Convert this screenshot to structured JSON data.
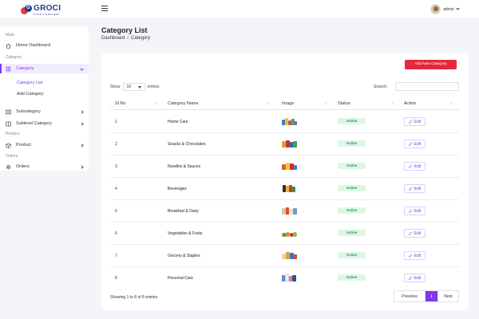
{
  "brand": {
    "name": "GROCI",
    "tagline": "FOOD & GROCERY",
    "mark_letter": "G",
    "accent": "#7c3aed",
    "danger": "#e5273b"
  },
  "header": {
    "user_name": "admin"
  },
  "sidebar": {
    "sections": [
      "Main",
      "Category",
      "Product",
      "Orders"
    ],
    "items": [
      {
        "label": "Home Dashboard",
        "icon": "home-icon"
      },
      {
        "label": "Category",
        "icon": "grid-icon",
        "active": true
      },
      {
        "label": "Subcategory",
        "icon": "list-icon"
      },
      {
        "label": "Sublevel Category",
        "icon": "columns-icon"
      },
      {
        "label": "Product",
        "icon": "box-icon"
      },
      {
        "label": "Orders",
        "icon": "gear-icon"
      }
    ],
    "category_sub": [
      "Category List",
      "Add Category"
    ]
  },
  "page": {
    "title": "Category List",
    "breadcrumb": [
      "Dashboard",
      "/",
      "Category"
    ]
  },
  "table_controls": {
    "add_button": "Add New Category",
    "show_label": "Show",
    "show_value": "10",
    "entries_label": "entries",
    "search_label": "Search:",
    "search_value": ""
  },
  "table": {
    "columns": [
      "Sl No",
      "Category Name",
      "Image",
      "Status",
      "Action"
    ],
    "sort_glyph": "↑↓",
    "rows": [
      {
        "no": "1",
        "name": "Home Care",
        "status": "Active",
        "action": "Edit",
        "image": "home-care-products-image"
      },
      {
        "no": "2",
        "name": "Snacks & Chocolates",
        "status": "Active",
        "action": "Edit",
        "image": "snacks-image"
      },
      {
        "no": "3",
        "name": "Noodles & Sauces",
        "status": "Active",
        "action": "Edit",
        "image": "noodles-image"
      },
      {
        "no": "4",
        "name": "Beverages",
        "status": "Active",
        "action": "Edit",
        "image": "beverages-image"
      },
      {
        "no": "5",
        "name": "Breakfast & Dairy",
        "status": "Active",
        "action": "Edit",
        "image": "breakfast-image"
      },
      {
        "no": "6",
        "name": "Vegetables & Fruits",
        "status": "Active",
        "action": "Edit",
        "image": "vegetables-image"
      },
      {
        "no": "7",
        "name": "Grocery & Staples",
        "status": "Active",
        "action": "Edit",
        "image": "grocery-image"
      },
      {
        "no": "8",
        "name": "Personal Care",
        "status": "Active",
        "action": "Edit",
        "image": "personal-care-image"
      }
    ]
  },
  "pagination": {
    "info": "Showing 1 to 8 of 8 entries",
    "prev": "Previous",
    "current": "1",
    "next": "Next"
  }
}
